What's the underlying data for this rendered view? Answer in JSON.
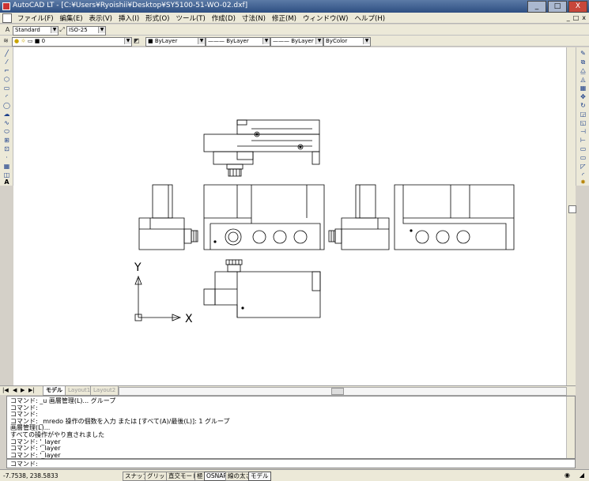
{
  "window": {
    "title": "AutoCAD LT - [C:¥Users¥Ryoishii¥Desktop¥SY5100-51-WO-02.dxf]",
    "controls": [
      "_",
      "□",
      "X"
    ]
  },
  "menubar": {
    "items": [
      "ファイル(F)",
      "編集(E)",
      "表示(V)",
      "挿入(I)",
      "形式(O)",
      "ツール(T)",
      "作成(D)",
      "寸法(N)",
      "修正(M)",
      "ウィンドウ(W)",
      "ヘルプ(H)"
    ],
    "doc_controls": [
      "_",
      "□",
      "x"
    ]
  },
  "styles_toolbar": {
    "text_style": "Standard",
    "dim_style": "ISO-25"
  },
  "layers_toolbar": {
    "layer": "0",
    "color": "ByLayer",
    "linetype": "ByLayer",
    "lineweight": "ByLayer",
    "plotstyle": "ByColor"
  },
  "drawing": {
    "ucs_y": "Y",
    "ucs_x": "X"
  },
  "layout_tabs": {
    "tabs": [
      "モデル",
      "Layout1",
      "Layout2"
    ],
    "active": "モデル"
  },
  "command_window": {
    "lines": [
      "コマンド: _u 画層管理(L)... グループ",
      "コマンド:",
      "コマンド:",
      "コマンド: _mredo 操作の個数を入力 または [すべて(A)/最後(L)]: 1 グループ",
      "画層管理(L)...",
      "すべての操作がやり直されました",
      "コマンド: '_layer",
      "コマンド: '_layer",
      "コマンド: '_layer"
    ],
    "prompt": "コマンド:"
  },
  "statusbar": {
    "coordinates": "-7.7538,  238.5833",
    "buttons": [
      {
        "label": "スナップ",
        "on": false
      },
      {
        "label": "グリッド",
        "on": false
      },
      {
        "label": "直交モード",
        "on": false
      },
      {
        "label": "極",
        "on": false
      },
      {
        "label": "OSNAP",
        "on": true
      },
      {
        "label": "線の太さ",
        "on": false
      },
      {
        "label": "モデル",
        "on": true
      }
    ]
  },
  "colors": {
    "titlebar": "#2e4f82",
    "toolbar_bg": "#ece9d8",
    "canvas": "#ffffff",
    "ink": "#000000",
    "close_btn": "#c7473a"
  }
}
